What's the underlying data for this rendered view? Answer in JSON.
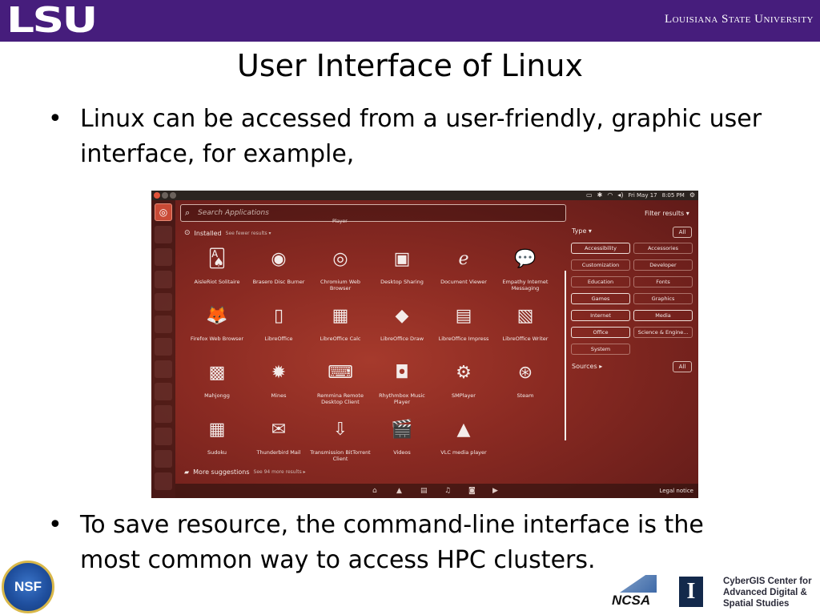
{
  "header": {
    "logo_text": "LSU",
    "university_name": "Louisiana State University",
    "band_color": "#461d7c"
  },
  "slide": {
    "title": "User Interface of Linux",
    "bullet_char": "•",
    "bullets": [
      "Linux can be accessed from a user-friendly, graphic user interface, for example,",
      "To save resource, the command-line interface is the most common way to access HPC clusters."
    ]
  },
  "screenshot": {
    "topbar": {
      "date": "Fri May 17",
      "time": "8:05 PM",
      "indicator_icons": [
        "battery-icon",
        "bluetooth-icon",
        "wifi-icon",
        "volume-icon"
      ],
      "settings_icon": "gear-icon"
    },
    "search": {
      "placeholder": "Search Applications"
    },
    "cut_label": "Player",
    "installed": {
      "label": "Installed",
      "see_fewer": "See fewer results ▾"
    },
    "apps": [
      {
        "label": "AisleRiot Solitaire",
        "icon": "cards-icon",
        "glyph": "🂡"
      },
      {
        "label": "Brasero Disc Burner",
        "icon": "disc-icon",
        "glyph": "◉"
      },
      {
        "label": "Chromium Web Browser",
        "icon": "chromium-icon",
        "glyph": "◎"
      },
      {
        "label": "Desktop Sharing",
        "icon": "desktop-sharing-icon",
        "glyph": "▣"
      },
      {
        "label": "Document Viewer",
        "icon": "document-viewer-icon",
        "glyph": "ℯ"
      },
      {
        "label": "Empathy Internet Messaging",
        "icon": "chat-icon",
        "glyph": "💬"
      },
      {
        "label": "Firefox Web Browser",
        "icon": "firefox-icon",
        "glyph": "🦊"
      },
      {
        "label": "LibreOffice",
        "icon": "libreoffice-icon",
        "glyph": "▯"
      },
      {
        "label": "LibreOffice Calc",
        "icon": "spreadsheet-icon",
        "glyph": "▦"
      },
      {
        "label": "LibreOffice Draw",
        "icon": "draw-icon",
        "glyph": "◆"
      },
      {
        "label": "LibreOffice Impress",
        "icon": "presentation-icon",
        "glyph": "▤"
      },
      {
        "label": "LibreOffice Writer",
        "icon": "writer-icon",
        "glyph": "▧"
      },
      {
        "label": "Mahjongg",
        "icon": "mahjongg-icon",
        "glyph": "▩"
      },
      {
        "label": "Mines",
        "icon": "mine-icon",
        "glyph": "✹"
      },
      {
        "label": "Remmina Remote Desktop Client",
        "icon": "remote-desktop-icon",
        "glyph": "⌨"
      },
      {
        "label": "Rhythmbox Music Player",
        "icon": "speaker-icon",
        "glyph": "◘"
      },
      {
        "label": "SMPlayer",
        "icon": "smplayer-icon",
        "glyph": "⚙"
      },
      {
        "label": "Steam",
        "icon": "steam-icon",
        "glyph": "⊛"
      },
      {
        "label": "Sudoku",
        "icon": "sudoku-icon",
        "glyph": "▦"
      },
      {
        "label": "Thunderbird Mail",
        "icon": "mail-icon",
        "glyph": "✉"
      },
      {
        "label": "Transmission BitTorrent Client",
        "icon": "torrent-icon",
        "glyph": "⇩"
      },
      {
        "label": "Videos",
        "icon": "clapper-icon",
        "glyph": "🎬"
      },
      {
        "label": "VLC media player",
        "icon": "vlc-icon",
        "glyph": "▲"
      }
    ],
    "more_suggestions": {
      "label": "More suggestions",
      "see_more": "See 94 more results ▸"
    },
    "filter": {
      "header": "Filter results ▾",
      "type_label": "Type ▾",
      "all_label": "All",
      "categories": [
        {
          "label": "Accessibility",
          "selected": true
        },
        {
          "label": "Accessories",
          "selected": false
        },
        {
          "label": "Customization",
          "selected": false
        },
        {
          "label": "Developer",
          "selected": false
        },
        {
          "label": "Education",
          "selected": false
        },
        {
          "label": "Fonts",
          "selected": false
        },
        {
          "label": "Games",
          "selected": true
        },
        {
          "label": "Graphics",
          "selected": false
        },
        {
          "label": "Internet",
          "selected": true
        },
        {
          "label": "Media",
          "selected": true
        },
        {
          "label": "Office",
          "selected": true
        },
        {
          "label": "Science & Engine...",
          "selected": false
        },
        {
          "label": "System",
          "selected": false
        }
      ],
      "sources_label": "Sources ▸",
      "sources_all_label": "All"
    },
    "lens_icons": [
      "home-lens-icon",
      "apps-lens-icon",
      "files-lens-icon",
      "music-lens-icon",
      "photos-lens-icon",
      "video-lens-icon"
    ],
    "legal_notice": "Legal notice"
  },
  "footer": {
    "nsf_text": "NSF",
    "ncsa_text": "NCSA",
    "illinois_text": "I",
    "cybergis_text": "CyberGIS Center for Advanced Digital & Spatial Studies"
  }
}
